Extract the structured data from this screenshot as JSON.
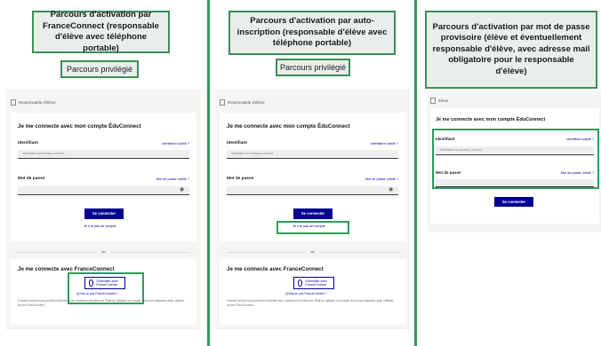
{
  "columns": [
    {
      "header": "Parcours d'activation par FranceConnect (responsable d'élève avec téléphone portable)",
      "badge": "Parcours privilégié",
      "role": "Responsable d'élève",
      "title_login": "Je me connecte avec mon compte ÉduConnect",
      "identifiant_label": "Identifiant",
      "identifiant_forgot": "Identifiant oublié ?",
      "identifiant_placeholder": "Identifiant au format p.nomXX",
      "password_label": "Mot de passe",
      "password_forgot": "Mot de passe oublié ?",
      "submit": "Se connecter",
      "no_account": "Je n'ai pas de compte",
      "or": "ou",
      "title_fc": "Je me connecte avec FranceConnect",
      "fc_button": "S'identifier avec FranceConnect",
      "fc_what": "Qu'est-ce que FranceConnect ?",
      "fc_note": "FranceConnect vous permet d'accéder à de nombreux services de l'État en utilisant un compte dont vous disposez déjà. Utilisez-le pour ÉduConnect !"
    },
    {
      "header": "Parcours d'activation par auto-inscription (responsable d'élève avec téléphone portable)",
      "badge": "Parcours privilégié",
      "role": "Responsable d'élève",
      "title_login": "Je me connecte avec mon compte ÉduConnect",
      "identifiant_label": "Identifiant",
      "identifiant_forgot": "Identifiant oublié ?",
      "identifiant_placeholder": "Identifiant au format p.nomXX",
      "password_label": "Mot de passe",
      "password_forgot": "Mot de passe oublié ?",
      "submit": "Se connecter",
      "no_account": "Je n'ai pas de compte",
      "or": "ou",
      "title_fc": "Je me connecte avec FranceConnect",
      "fc_button": "S'identifier avec FranceConnect",
      "fc_what": "Qu'est-ce que FranceConnect ?",
      "fc_note": "FranceConnect vous permet d'accéder à de nombreux services de l'État en utilisant un compte dont vous disposez déjà. Utilisez-le pour ÉduConnect !"
    },
    {
      "header": "Parcours d'activation par mot de passe provisoire (élève et éventuellement responsable d'élève, avec adresse mail obligatoire pour le responsable d'élève)",
      "role": "Élève",
      "title_login": "Je me connecte avec mon compte ÉduConnect",
      "identifiant_label": "Identifiant",
      "identifiant_forgot": "Identifiant oublié ?",
      "identifiant_placeholder": "Identifiant au format p.nomXX",
      "password_label": "Mot de passe",
      "password_forgot": "Mot de passe oublié ?",
      "submit": "Se connecter"
    }
  ],
  "colors": {
    "accent_green": "#2e9c57",
    "button_blue": "#000091"
  }
}
